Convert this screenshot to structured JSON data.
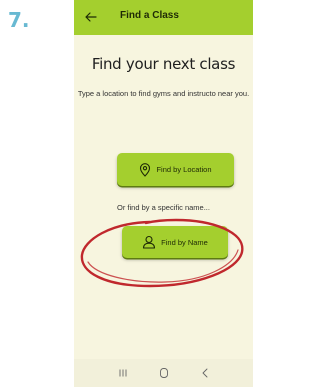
{
  "step_number": "7.",
  "app_bar": {
    "title": "Find a Class"
  },
  "main": {
    "headline": "Find your next class",
    "subtitle": "Type a location to find gyms and instructo near you.",
    "location_button_label": "Find by Location",
    "or_text": "Or find by a specific name...",
    "name_button_label": "Find by Name"
  },
  "nav_bar": {
    "recents_glyph": "III",
    "home_glyph": "○",
    "back_glyph": "<"
  },
  "colors": {
    "accent": "#a4cf2e",
    "background": "#f7f5df",
    "annotation": "#c0282d",
    "step_number": "#68b9d2"
  }
}
